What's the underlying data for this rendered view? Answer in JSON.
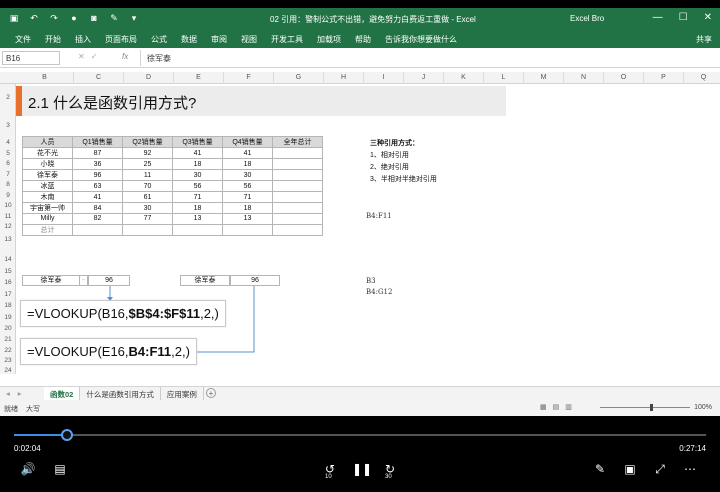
{
  "titlebar": {
    "title": "02 引用：警制公式不出错，避免努力白费返工重做 - Excel",
    "user": "Excel Bro",
    "win_min": "—",
    "win_restore": "☐",
    "win_close": "✕"
  },
  "ribbon": {
    "tabs": [
      "文件",
      "开始",
      "插入",
      "页面布局",
      "公式",
      "数据",
      "审阅",
      "视图",
      "开发工具",
      "加载项",
      "帮助",
      "告诉我你想要做什么"
    ],
    "share": "共享"
  },
  "formula_bar": {
    "name_box": "B16",
    "fx": "fx",
    "content": "徐军泰"
  },
  "columns": [
    "B",
    "C",
    "D",
    "E",
    "F",
    "G",
    "H",
    "I",
    "J",
    "K",
    "L",
    "M",
    "N",
    "O",
    "P",
    "Q"
  ],
  "rows": [
    "2",
    "3",
    "4",
    "5",
    "6",
    "7",
    "8",
    "9",
    "10",
    "11",
    "12",
    "13",
    "14",
    "15",
    "16",
    "17",
    "18",
    "19",
    "20",
    "21",
    "22",
    "23",
    "24"
  ],
  "banner": "2.1  什么是函数引用方式?",
  "table": {
    "headers": [
      "人员",
      "Q1销售量",
      "Q2销售量",
      "Q3销售量",
      "Q4销售量",
      "全年总计"
    ],
    "rows": [
      [
        "花不光",
        "87",
        "92",
        "41",
        "41",
        ""
      ],
      [
        "小晓",
        "36",
        "25",
        "18",
        "18",
        ""
      ],
      [
        "徐军泰",
        "96",
        "11",
        "30",
        "30",
        ""
      ],
      [
        "冰蓝",
        "63",
        "70",
        "56",
        "56",
        ""
      ],
      [
        "木南",
        "41",
        "61",
        "71",
        "71",
        ""
      ],
      [
        "宇宙第一帅",
        "84",
        "30",
        "18",
        "18",
        ""
      ],
      [
        "Milly",
        "82",
        "77",
        "13",
        "13",
        ""
      ],
      [
        "总计",
        "",
        "",
        "",
        "",
        ""
      ]
    ]
  },
  "notes": {
    "heading": "三种引用方式：",
    "items": [
      "1、相对引用",
      "2、绝对引用",
      "3、半相对半绝对引用"
    ]
  },
  "side_refs": {
    "ref1": "B4:F11",
    "ref2": "B3",
    "ref3": "B4:G12"
  },
  "lookup1": {
    "name": "徐军泰",
    "value": "96"
  },
  "lookup2": {
    "name": "徐军泰",
    "value": "96"
  },
  "formula1": {
    "prefix": "=VLOOKUP(B16,",
    "bold": "$B$4:$F$11",
    "suffix": ",2,)"
  },
  "formula2": {
    "prefix": "=VLOOKUP(E16,",
    "bold": "B4:F11",
    "suffix": ",2,)"
  },
  "sheets": [
    "函数02",
    "什么是函数引用方式",
    "应用案例"
  ],
  "status": {
    "ready": "就绪",
    "caps": "大写",
    "zoom": "100%"
  },
  "player": {
    "current": "0:02:04",
    "total": "0:27:14",
    "progress": 0.076,
    "skip_back": "10",
    "skip_fwd": "30"
  }
}
